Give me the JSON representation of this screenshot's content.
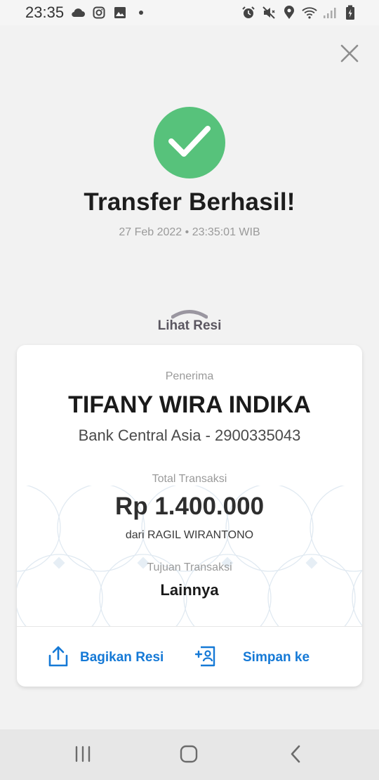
{
  "status_bar": {
    "time": "23:35",
    "left_icons": [
      "cloud-icon",
      "instagram-icon",
      "image-icon",
      "dot-icon"
    ],
    "right_icons": [
      "alarm-icon",
      "mute-icon",
      "location-icon",
      "wifi-icon",
      "signal-icon",
      "battery-icon"
    ]
  },
  "header": {
    "close_icon": "close-icon",
    "success_icon": "check-circle-icon",
    "title": "Transfer Berhasil!",
    "datetime": "27 Feb 2022 • 23:35:01 WIB"
  },
  "receipt_toggle": {
    "label": "Lihat Resi",
    "icon": "chevron-up-icon"
  },
  "receipt": {
    "recipient_label": "Penerima",
    "recipient_name": "TIFANY WIRA INDIKA",
    "bank_info": "Bank Central Asia - 2900335043",
    "total_label": "Total Transaksi",
    "amount": "Rp 1.400.000",
    "sender": "dari RAGIL WIRANTONO",
    "purpose_label": "Tujuan Transaksi",
    "purpose": "Lainnya"
  },
  "actions": {
    "share_label": "Bagikan Resi",
    "save_label": "Simpan ke"
  },
  "nav_bar": {
    "items": [
      "recent-apps-icon",
      "home-icon",
      "back-icon"
    ]
  },
  "colors": {
    "success": "#57c27b",
    "accent": "#1579d6",
    "background": "#f2f2f2"
  }
}
